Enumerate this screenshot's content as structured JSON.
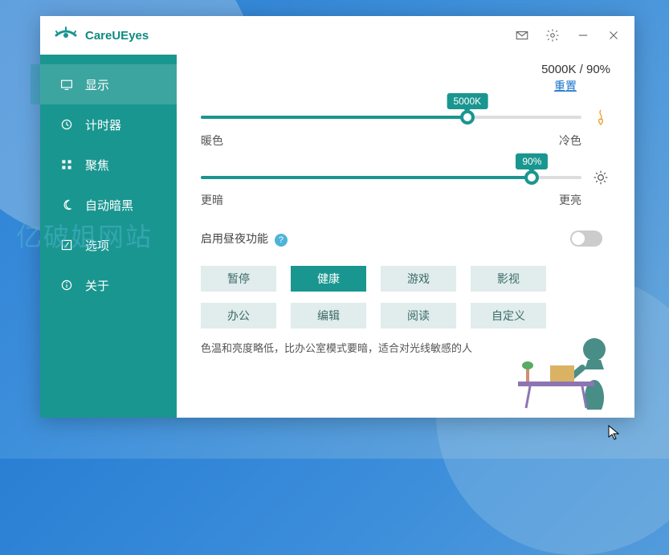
{
  "app": {
    "title": "CareUEyes"
  },
  "watermark": "亿破姐网站",
  "sidebar": {
    "items": [
      {
        "label": "显示",
        "icon": "display"
      },
      {
        "label": "计时器",
        "icon": "clock"
      },
      {
        "label": "聚焦",
        "icon": "grid"
      },
      {
        "label": "自动暗黑",
        "icon": "moon"
      },
      {
        "label": "选项",
        "icon": "settings"
      },
      {
        "label": "关于",
        "icon": "info"
      }
    ]
  },
  "status": {
    "text": "5000K / 90%",
    "reset": "重置"
  },
  "sliders": {
    "temp": {
      "badge": "5000K",
      "left": "暖色",
      "right": "冷色",
      "percent": 70
    },
    "bright": {
      "badge": "90%",
      "left": "更暗",
      "right": "更亮",
      "percent": 87
    }
  },
  "toggle": {
    "label": "启用昼夜功能"
  },
  "modes": {
    "row1": [
      {
        "label": "暂停",
        "active": false
      },
      {
        "label": "健康",
        "active": true
      },
      {
        "label": "游戏",
        "active": false
      },
      {
        "label": "影视",
        "active": false
      }
    ],
    "row2": [
      {
        "label": "办公",
        "active": false
      },
      {
        "label": "编辑",
        "active": false
      },
      {
        "label": "阅读",
        "active": false
      },
      {
        "label": "自定义",
        "active": false
      }
    ]
  },
  "description": "色温和亮度略低，比办公室模式要暗，适合对光线敏感的人"
}
